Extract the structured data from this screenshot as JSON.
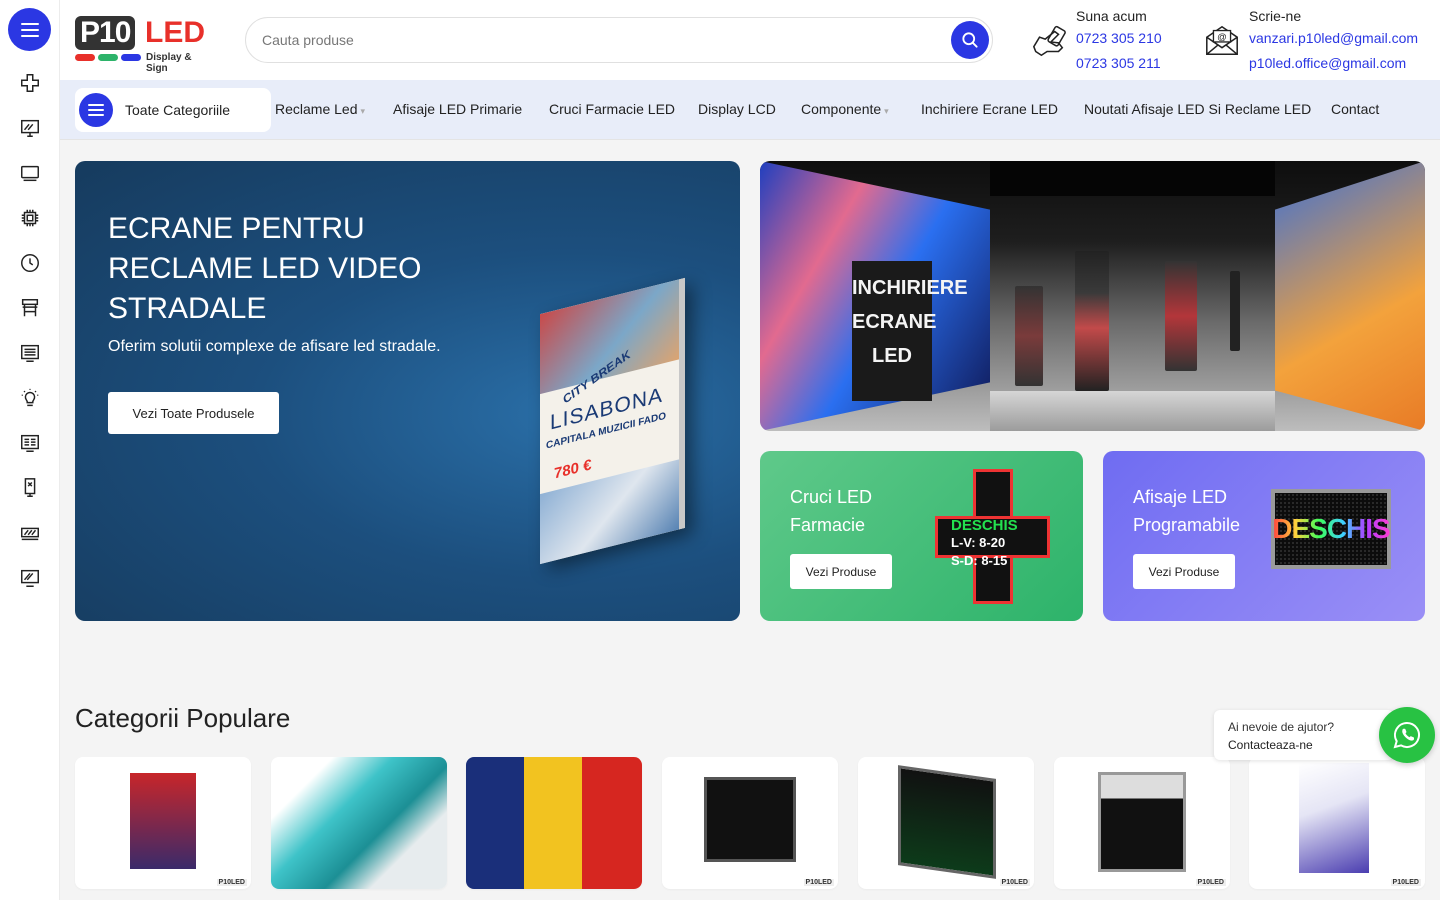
{
  "header": {
    "logo": {
      "p10": "P10",
      "led": "LED",
      "tagline": "Display & Sign",
      "dot_colors": [
        "#e8302a",
        "#2db36a",
        "#2b37e3"
      ]
    },
    "search": {
      "placeholder": "Cauta produse",
      "icon": "search-icon"
    },
    "call": {
      "title": "Suna acum",
      "phone1": "0723 305 210",
      "phone2": "0723 305 211",
      "icon": "phone-hand-icon"
    },
    "email": {
      "title": "Scrie-ne",
      "email1": "vanzari.p10led@gmail.com",
      "email2": "p10led.office@gmail.com",
      "icon": "mail-icon"
    }
  },
  "sidebar": {
    "icons": [
      "menu-icon",
      "cross-icon",
      "monitor-icon",
      "display-icon",
      "chip-icon",
      "clock-icon",
      "stand-icon",
      "message-board-icon",
      "bulb-icon",
      "panel-icon",
      "totem-icon",
      "led-strip-icon",
      "screen-icon"
    ]
  },
  "nav": {
    "all_categories": "Toate Categoriile",
    "items": [
      {
        "label": "Reclame Led",
        "has_dropdown": true
      },
      {
        "label": "Afisaje LED Primarie",
        "has_dropdown": false
      },
      {
        "label": "Cruci Farmacie LED",
        "has_dropdown": false
      },
      {
        "label": "Display LCD",
        "has_dropdown": false
      },
      {
        "label": "Componente",
        "has_dropdown": true
      },
      {
        "label": "Inchiriere Ecrane LED",
        "has_dropdown": false
      },
      {
        "label": "Noutati Afisaje LED Si Reclame LED",
        "has_dropdown": false
      },
      {
        "label": "Contact",
        "has_dropdown": false
      }
    ]
  },
  "hero": {
    "title": "ECRANE PENTRU RECLAME LED VIDEO STRADALE",
    "subtitle": "Oferim solutii complexe de afisare led stradale.",
    "button": "Vezi Toate Produsele",
    "poster": {
      "city_break": "CITY BREAK",
      "title": "LISABONA",
      "line": "CAPITALA MUZICII FADO",
      "price": "780 €"
    }
  },
  "showroom": {
    "sign": "INCHIRIERE ECRANE LED"
  },
  "promos": [
    {
      "title": "Cruci LED Farmacie",
      "button": "Vezi Produse",
      "sign_text": "DESCHIS",
      "hours1": "L-V: 8-20",
      "hours2": "S-D: 8-15"
    },
    {
      "title": "Afisaje LED Programabile",
      "button": "Vezi Produse",
      "sign_text": "DESCHIS"
    }
  ],
  "popular": {
    "title": "Categorii Populare",
    "cards": [
      {
        "name": "exchange-rates-display"
      },
      {
        "name": "led-totem"
      },
      {
        "name": "primarie-display"
      },
      {
        "name": "pharmacy-cross-deschis"
      },
      {
        "name": "scrolling-text-display"
      },
      {
        "name": "fuel-price-display"
      },
      {
        "name": "counter-display"
      }
    ],
    "watermark": "P10LED"
  },
  "whatsapp": {
    "question": "Ai nevoie de ajutor?",
    "cta": "Contacteaza-ne"
  },
  "colors": {
    "accent": "#2b37e3",
    "brand_red": "#e8302a",
    "whatsapp": "#28c243"
  }
}
